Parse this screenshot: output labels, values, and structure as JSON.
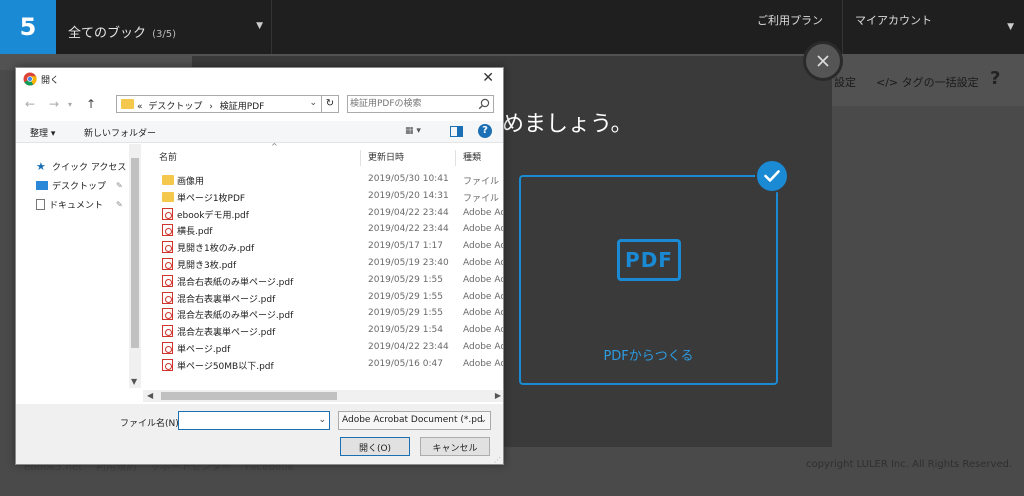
{
  "app": {
    "logo_text": "5",
    "book_select": {
      "label": "全てのブック",
      "count": "(3/5)"
    },
    "plan_link": "ご利用プラン",
    "account_label": "マイアカウント",
    "subnav": {
      "setting_fragment": "設定",
      "tag_bulk": "</> タグの一括設定",
      "help": "?"
    },
    "footer_links": [
      "ebook5.net",
      "利用規約",
      "サポートセンター",
      "Facebook"
    ],
    "copyright": "copyright LULER Inc. All Rights Reserved.",
    "colors": {
      "accent": "#1a8ad4",
      "topbar": "#1f1f1f",
      "overlay": "#4a4a4a",
      "modal": "#3a3a3a"
    }
  },
  "modal": {
    "heading_fragment": "めましょう。",
    "card_icon_text": "PDF",
    "card_caption": "PDFからつくる",
    "check_icon": "check-icon",
    "close_icon": "close-icon"
  },
  "dialog": {
    "title": "開く",
    "address": {
      "prefix": "«",
      "path": [
        "デスクトップ",
        "検証用PDF"
      ]
    },
    "search_placeholder": "検証用PDFの検索",
    "toolbar": {
      "organize": "整理 ▾",
      "new_folder": "新しいフォルダー",
      "view": "▦ ▾"
    },
    "nav_pane": [
      {
        "label": "クイック アクセス",
        "icon": "star-icon"
      },
      {
        "label": "デスクトップ",
        "icon": "desktop-icon"
      },
      {
        "label": "ドキュメント",
        "icon": "document-icon"
      }
    ],
    "columns": [
      "名前",
      "更新日時",
      "種類"
    ],
    "files": [
      {
        "name": "画像用",
        "date": "2019/05/30 10:41",
        "type": "ファイル フォ",
        "kind": "folder"
      },
      {
        "name": "単ページ1枚PDF",
        "date": "2019/05/20 14:31",
        "type": "ファイル フォ",
        "kind": "folder"
      },
      {
        "name": "ebookデモ用.pdf",
        "date": "2019/04/22 23:44",
        "type": "Adobe Ac",
        "kind": "pdf"
      },
      {
        "name": "横長.pdf",
        "date": "2019/04/22 23:44",
        "type": "Adobe Ac",
        "kind": "pdf"
      },
      {
        "name": "見開き1枚のみ.pdf",
        "date": "2019/05/17 1:17",
        "type": "Adobe Ac",
        "kind": "pdf"
      },
      {
        "name": "見開き3枚.pdf",
        "date": "2019/05/19 23:40",
        "type": "Adobe Ac",
        "kind": "pdf"
      },
      {
        "name": "混合右表紙のみ単ページ.pdf",
        "date": "2019/05/29 1:55",
        "type": "Adobe Ac",
        "kind": "pdf"
      },
      {
        "name": "混合右表裏単ページ.pdf",
        "date": "2019/05/29 1:55",
        "type": "Adobe Ac",
        "kind": "pdf"
      },
      {
        "name": "混合左表紙のみ単ページ.pdf",
        "date": "2019/05/29 1:55",
        "type": "Adobe Ac",
        "kind": "pdf"
      },
      {
        "name": "混合左表裏単ページ.pdf",
        "date": "2019/05/29 1:54",
        "type": "Adobe Ac",
        "kind": "pdf"
      },
      {
        "name": "単ページ.pdf",
        "date": "2019/04/22 23:44",
        "type": "Adobe Ac",
        "kind": "pdf"
      },
      {
        "name": "単ページ50MB以下.pdf",
        "date": "2019/05/16 0:47",
        "type": "Adobe Ac",
        "kind": "pdf"
      }
    ],
    "filename_label": "ファイル名(N):",
    "filename_value": "",
    "filter_value": "Adobe Acrobat Document (*.pd",
    "open_button": "開く(O)",
    "cancel_button": "キャンセル"
  }
}
